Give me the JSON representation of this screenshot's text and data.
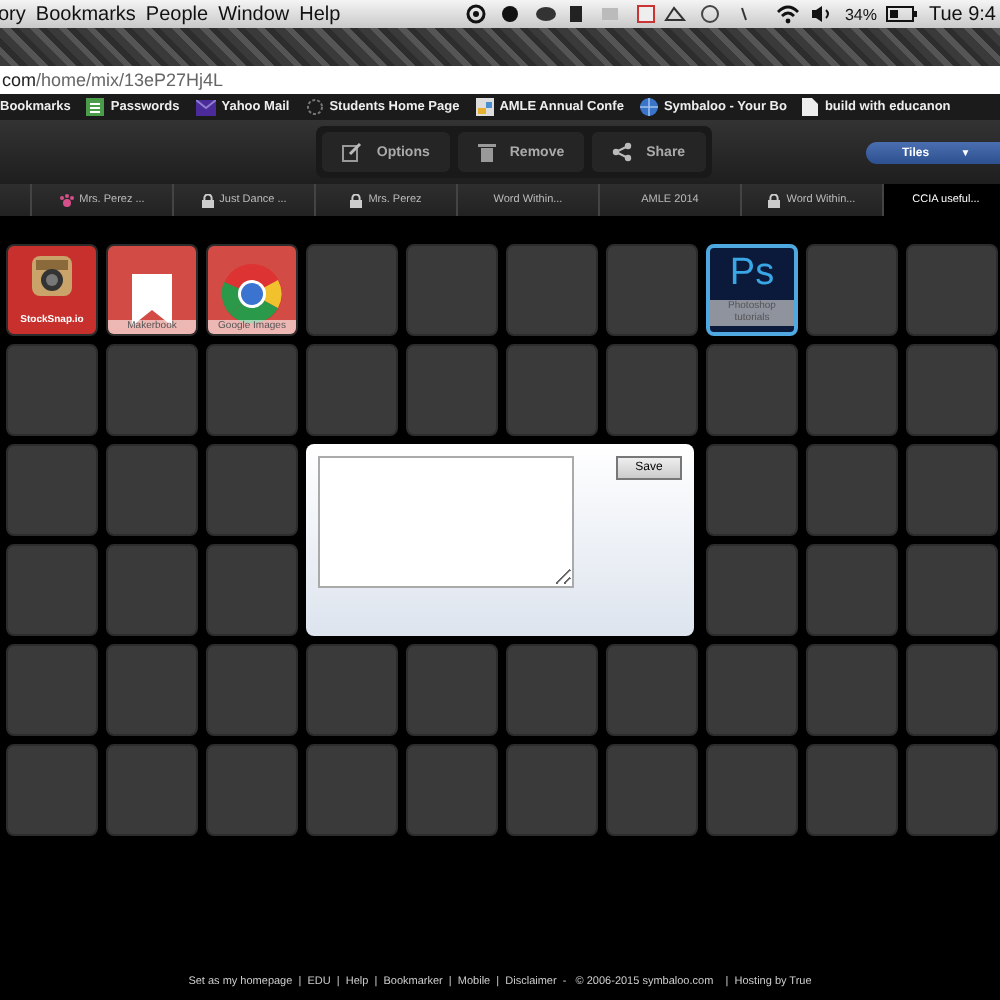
{
  "menubar": {
    "items": [
      "ory",
      "Bookmarks",
      "People",
      "Window",
      "Help"
    ],
    "battery": "34%",
    "clock": "Tue 9:4"
  },
  "address_bar": {
    "host": "com",
    "path": "/home/mix/13eP27Hj4L"
  },
  "bookmarks": [
    {
      "label": "Bookmarks",
      "kind": "plain"
    },
    {
      "label": "Passwords",
      "kind": "sheet"
    },
    {
      "label": "Yahoo Mail",
      "kind": "mail"
    },
    {
      "label": "Students Home Page",
      "kind": "spinner"
    },
    {
      "label": "AMLE Annual Confe",
      "kind": "doc"
    },
    {
      "label": "Symbaloo - Your Bo",
      "kind": "globe"
    },
    {
      "label": "build with educanon",
      "kind": "page"
    }
  ],
  "toolbar": {
    "buttons": [
      "Options",
      "Remove",
      "Share"
    ],
    "view": {
      "label": "Tiles",
      "caret": "▼"
    }
  },
  "tabs": [
    {
      "label": "Mrs. Perez ...",
      "kind": "paw",
      "selected": false
    },
    {
      "label": "Just Dance ...",
      "kind": "lock",
      "selected": false
    },
    {
      "label": "Mrs. Perez",
      "kind": "lock",
      "selected": false
    },
    {
      "label": "Word Within...",
      "kind": "plain",
      "selected": false
    },
    {
      "label": "AMLE 2014",
      "kind": "plain",
      "selected": false
    },
    {
      "label": "Word Within...",
      "kind": "lock",
      "selected": false
    },
    {
      "label": "CCIA useful...",
      "kind": "plain",
      "selected": true
    }
  ],
  "tiles": [
    {
      "kind": "camera",
      "label": "StockSnap.io",
      "selected": false
    },
    {
      "kind": "bookmark",
      "label": "Makerbook",
      "selected": false
    },
    {
      "kind": "browser",
      "label": "Google Images",
      "selected": false
    },
    {
      "kind": "empty",
      "selected": false
    },
    {
      "kind": "empty",
      "selected": false
    },
    {
      "kind": "empty",
      "selected": false
    },
    {
      "kind": "empty",
      "selected": false
    },
    {
      "kind": "ps",
      "logo": "Ps",
      "label": "Photoshop tutorials",
      "selected": true
    },
    {
      "kind": "empty",
      "selected": false
    },
    {
      "kind": "empty",
      "selected": false
    },
    {
      "kind": "empty",
      "selected": false
    },
    {
      "kind": "empty",
      "selected": false
    },
    {
      "kind": "empty",
      "selected": false
    },
    {
      "kind": "empty",
      "selected": false
    },
    {
      "kind": "empty",
      "selected": false
    },
    {
      "kind": "empty",
      "selected": false
    },
    {
      "kind": "empty",
      "selected": false
    },
    {
      "kind": "empty",
      "selected": false
    },
    {
      "kind": "empty",
      "selected": false
    },
    {
      "kind": "empty",
      "selected": false
    },
    {
      "kind": "empty",
      "selected": false
    },
    {
      "kind": "empty",
      "selected": false
    },
    {
      "kind": "empty",
      "selected": false
    },
    {
      "kind": "empty",
      "selected": false
    },
    {
      "kind": "empty",
      "selected": false
    },
    {
      "kind": "empty",
      "selected": false
    },
    {
      "kind": "empty",
      "selected": false
    },
    {
      "kind": "empty",
      "selected": false
    },
    {
      "kind": "empty",
      "selected": false
    },
    {
      "kind": "empty",
      "selected": false
    },
    {
      "kind": "empty",
      "selected": false
    },
    {
      "kind": "empty",
      "selected": false
    },
    {
      "kind": "empty",
      "selected": false
    },
    {
      "kind": "empty",
      "selected": false
    },
    {
      "kind": "empty",
      "selected": false
    },
    {
      "kind": "empty",
      "selected": false
    },
    {
      "kind": "empty",
      "selected": false
    },
    {
      "kind": "empty",
      "selected": false
    },
    {
      "kind": "empty",
      "selected": false
    },
    {
      "kind": "empty",
      "selected": false
    },
    {
      "kind": "empty",
      "selected": false
    },
    {
      "kind": "empty",
      "selected": false
    },
    {
      "kind": "empty",
      "selected": false
    },
    {
      "kind": "empty",
      "selected": false
    },
    {
      "kind": "empty",
      "selected": false
    },
    {
      "kind": "empty",
      "selected": false
    },
    {
      "kind": "empty",
      "selected": false
    },
    {
      "kind": "empty",
      "selected": false
    },
    {
      "kind": "empty",
      "selected": false
    },
    {
      "kind": "empty",
      "selected": false
    },
    {
      "kind": "empty",
      "selected": false
    },
    {
      "kind": "empty",
      "selected": false
    }
  ],
  "note_popup": {
    "save_button": "Save"
  },
  "footer": "Set as my homepage  |  EDU  |  Help  |  Bookmarker  |  Mobile  |  Disclaimer  -   © 2006-2015 symbaloo.com    |  Hosting by True"
}
